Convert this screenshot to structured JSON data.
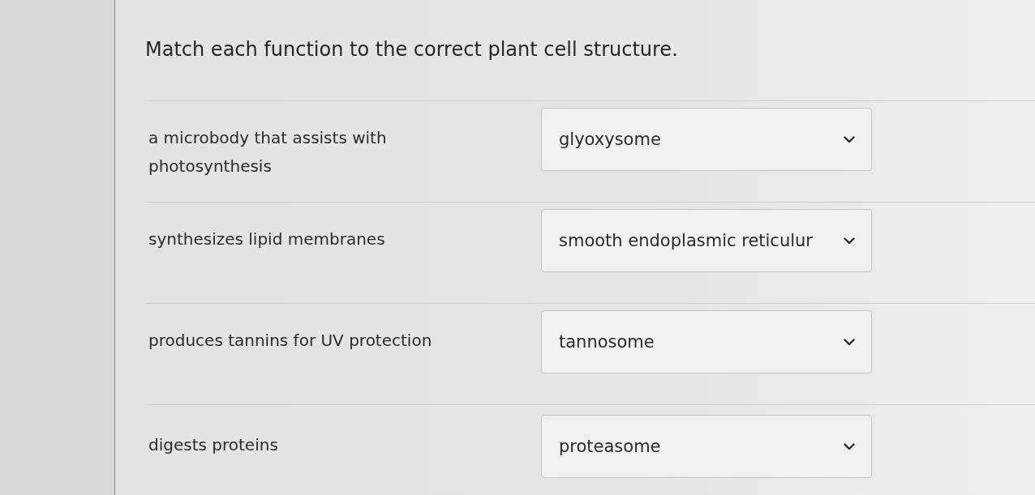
{
  "title": "Match each function to the correct plant cell structure.",
  "rows": [
    {
      "prompt": "a microbody that assists with photosynthesis",
      "answer": "glyoxysome"
    },
    {
      "prompt": "synthesizes lipid membranes",
      "answer": "smooth endoplasmic reticulur"
    },
    {
      "prompt": "produces tannins for UV protection",
      "answer": "tannosome"
    },
    {
      "prompt": "digests proteins",
      "answer": "proteasome"
    }
  ]
}
